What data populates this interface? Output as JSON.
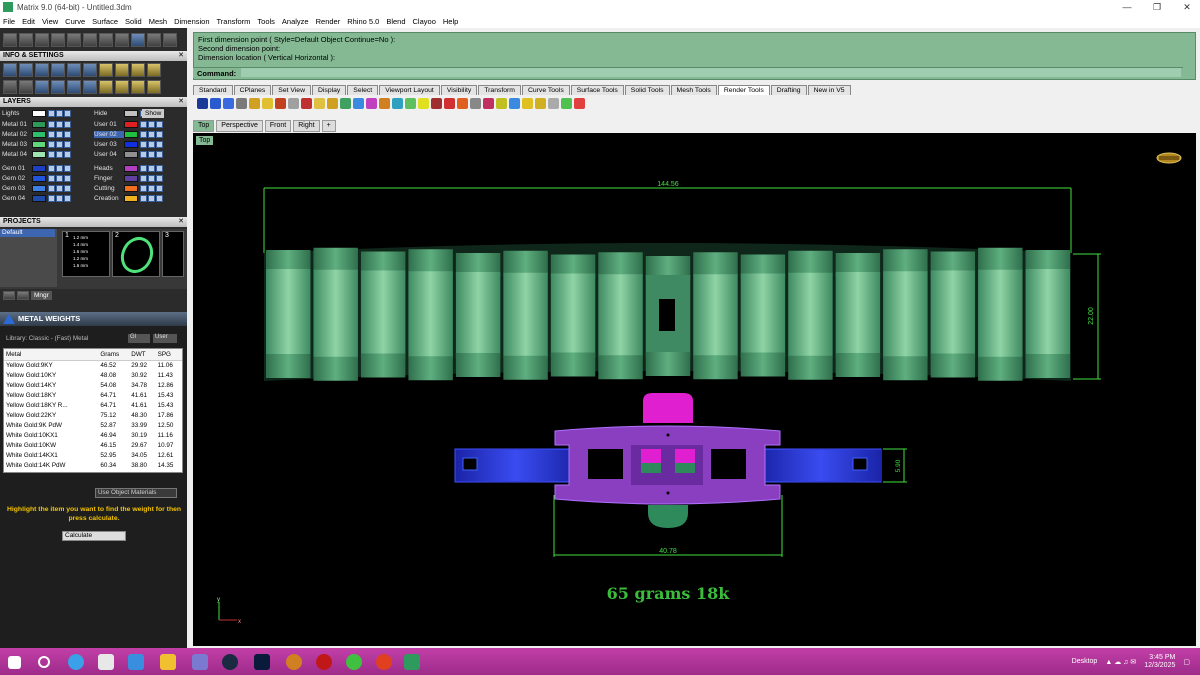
{
  "window": {
    "title": "Matrix 9.0 (64-bit) - Untitled.3dm"
  },
  "menu": [
    "File",
    "Edit",
    "View",
    "Curve",
    "Surface",
    "Solid",
    "Mesh",
    "Dimension",
    "Transform",
    "Tools",
    "Analyze",
    "Render",
    "Rhino 5.0",
    "Blend",
    "Clayoo",
    "Help"
  ],
  "left": {
    "info_header": "INFO & SETTINGS",
    "layers_header": "LAYERS",
    "layers_left": [
      {
        "name": "Lights",
        "color": "#ffffff"
      },
      {
        "name": "Metal 01",
        "color": "#2e9a5a"
      },
      {
        "name": "Metal 02",
        "color": "#2dbf6a"
      },
      {
        "name": "Metal 03",
        "color": "#5fd87c"
      },
      {
        "name": "Metal 04",
        "color": "#9ee5b0"
      },
      {
        "name": "Gem 01",
        "color": "#1e3fbf"
      },
      {
        "name": "Gem 02",
        "color": "#2255dd"
      },
      {
        "name": "Gem 03",
        "color": "#3c7fe6"
      },
      {
        "name": "Gem 04",
        "color": "#1f4aa8"
      }
    ],
    "layers_right": [
      {
        "name": "Hide",
        "color": "#c0c0c0"
      },
      {
        "name": "User 01",
        "color": "#e02020"
      },
      {
        "name": "User 02",
        "color": "#20c040"
      },
      {
        "name": "User 03",
        "color": "#1030e0"
      },
      {
        "name": "User 04",
        "color": "#909090"
      },
      {
        "name": "Heads",
        "color": "#b040c0"
      },
      {
        "name": "Finger",
        "color": "#6040a0"
      },
      {
        "name": "Cutting",
        "color": "#f07020"
      },
      {
        "name": "Creation",
        "color": "#f0b020"
      }
    ],
    "show_label": "Show",
    "projects_header": "PROJECTS",
    "project_default": "Default",
    "thumb_numbers": [
      "1",
      "2",
      "3"
    ],
    "thumb1_sizes": [
      "1.2 mm",
      "1.4 mm",
      "1.6 mm",
      "1.2 mm",
      "1.6 mm"
    ],
    "mingr_label": "Mngr",
    "metal_weights": {
      "title": "METAL WEIGHTS",
      "library": "Library: Classic - (Fast) Metal",
      "library_btn1": "Gl",
      "library_btn2": "User",
      "columns": [
        "Metal",
        "Grams",
        "DWT",
        "SPG"
      ],
      "rows": [
        [
          "Yellow Gold:9KY",
          "46.52",
          "29.92",
          "11.06"
        ],
        [
          "Yellow Gold:10KY",
          "48.08",
          "30.92",
          "11.43"
        ],
        [
          "Yellow Gold:14KY",
          "54.08",
          "34.78",
          "12.86"
        ],
        [
          "Yellow Gold:18KY",
          "64.71",
          "41.61",
          "15.43"
        ],
        [
          "Yellow Gold:18KY R...",
          "64.71",
          "41.61",
          "15.43"
        ],
        [
          "Yellow Gold:22KY",
          "75.12",
          "48.30",
          "17.86"
        ],
        [
          "White Gold:9K PdW",
          "52.87",
          "33.99",
          "12.50"
        ],
        [
          "White Gold:10KX1",
          "46.94",
          "30.19",
          "11.16"
        ],
        [
          "White Gold:10KW",
          "46.15",
          "29.67",
          "10.97"
        ],
        [
          "White Gold:14KX1",
          "52.95",
          "34.05",
          "12.61"
        ],
        [
          "White Gold:14K PdW",
          "60.34",
          "38.80",
          "14.35"
        ]
      ],
      "use_object_materials": "Use Object Materials",
      "hint": "Highlight the item you want to find the weight for then press calculate.",
      "calculate": "Calculate"
    }
  },
  "command": {
    "history": [
      "First dimension point ( Style=Default  Object  Continue=No ):",
      "Second dimension point:",
      "Dimension location ( Vertical  Horizontal ):"
    ],
    "label": "Command:"
  },
  "tool_tabs": [
    "Standard",
    "CPlanes",
    "Set View",
    "Display",
    "Select",
    "Viewport Layout",
    "Visibility",
    "Transform",
    "Curve Tools",
    "Surface Tools",
    "Solid Tools",
    "Mesh Tools",
    "Render Tools",
    "Drafting",
    "New in V5"
  ],
  "active_tool_tab": "Render Tools",
  "viewport_tabs": [
    "Top",
    "Perspective",
    "Front",
    "Right",
    "+"
  ],
  "viewport_label": "Top",
  "dimensions": {
    "width_top": "144.56",
    "height_right": "22.00",
    "clasp_width": "40.78",
    "clasp_height": "5.90"
  },
  "weight_note": "65 grams 18k",
  "axis": {
    "y": "y",
    "x": "x"
  },
  "taskbar": {
    "desktop": "Desktop",
    "time": "3:45 PM",
    "date": "12/3/2025"
  },
  "colors": {
    "viewport_bg": "#000000",
    "cmd_bg": "#84b994",
    "taskbar": "#b0359a",
    "dimension": "#3fe03f",
    "link": "#5fa37a",
    "clasp_purple": "#8a3fc0",
    "clasp_blue": "#2233dd",
    "magenta": "#e020d0"
  }
}
